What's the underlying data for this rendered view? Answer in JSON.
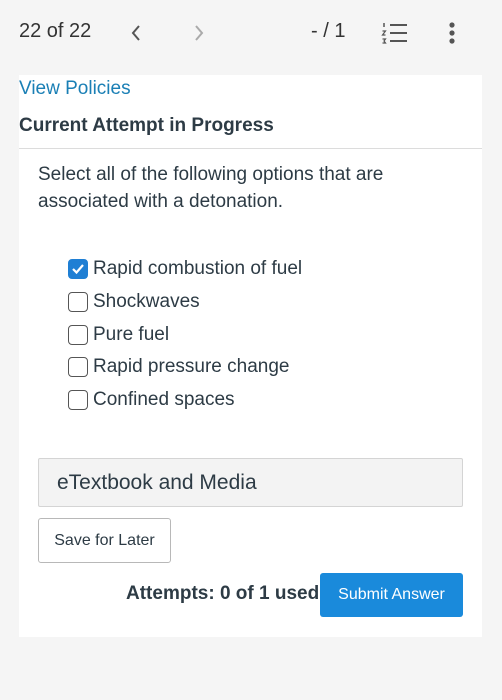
{
  "topbar": {
    "counter": "22 of 22",
    "score": "- / 1",
    "icons": {
      "prev": "chevron-left-icon",
      "next": "chevron-right-icon",
      "list": "numbered-list-icon",
      "more": "more-vertical-icon"
    }
  },
  "content": {
    "view_policies": "View Policies",
    "attempt_heading": "Current Attempt in Progress",
    "prompt": "Select all of the following options that are associated with a detonation.",
    "options": [
      {
        "label": "Rapid combustion of fuel",
        "checked": true
      },
      {
        "label": "Shockwaves",
        "checked": false
      },
      {
        "label": "Pure fuel",
        "checked": false
      },
      {
        "label": "Rapid pressure change",
        "checked": false
      },
      {
        "label": "Confined spaces",
        "checked": false
      }
    ],
    "etextbook": "eTextbook and Media",
    "save_later": "Save for Later",
    "attempts": "Attempts: 0 of 1 used",
    "submit": "Submit Answer"
  },
  "colors": {
    "link": "#1a7fb5",
    "accent": "#1a8adb",
    "checked": "#1f7fd4"
  }
}
